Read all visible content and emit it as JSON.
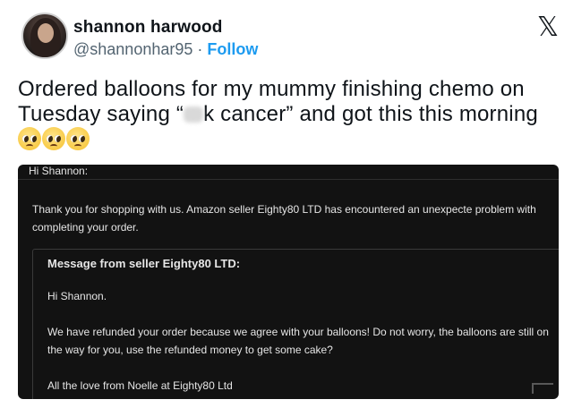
{
  "tweet": {
    "author_name": "shannon harwood",
    "handle": "@shannonhar95",
    "separator": " · ",
    "follow_label": "Follow",
    "platform_icon": "x-logo-icon",
    "text_part1": "Ordered balloons for my mummy finishing chemo on Tuesday saying “",
    "text_part2": "k cancer” and got this this morning",
    "emoji": [
      "pleading-face-icon",
      "pleading-face-icon",
      "pleading-face-icon"
    ]
  },
  "email": {
    "greeting": "Hi Shannon:",
    "paragraph": "Thank you for shopping with us. Amazon seller Eighty80 LTD has encountered an unexpecte problem with completing your order.",
    "seller_box": {
      "heading": "Message from seller Eighty80 LTD:",
      "hi": "Hi Shannon.",
      "body": "We have refunded your order because we agree with your balloons! Do not worry, the balloons are still on the way for you, use the refunded money to get some cake?",
      "signoff": "All the love from Noelle at Eighty80 Ltd"
    }
  }
}
